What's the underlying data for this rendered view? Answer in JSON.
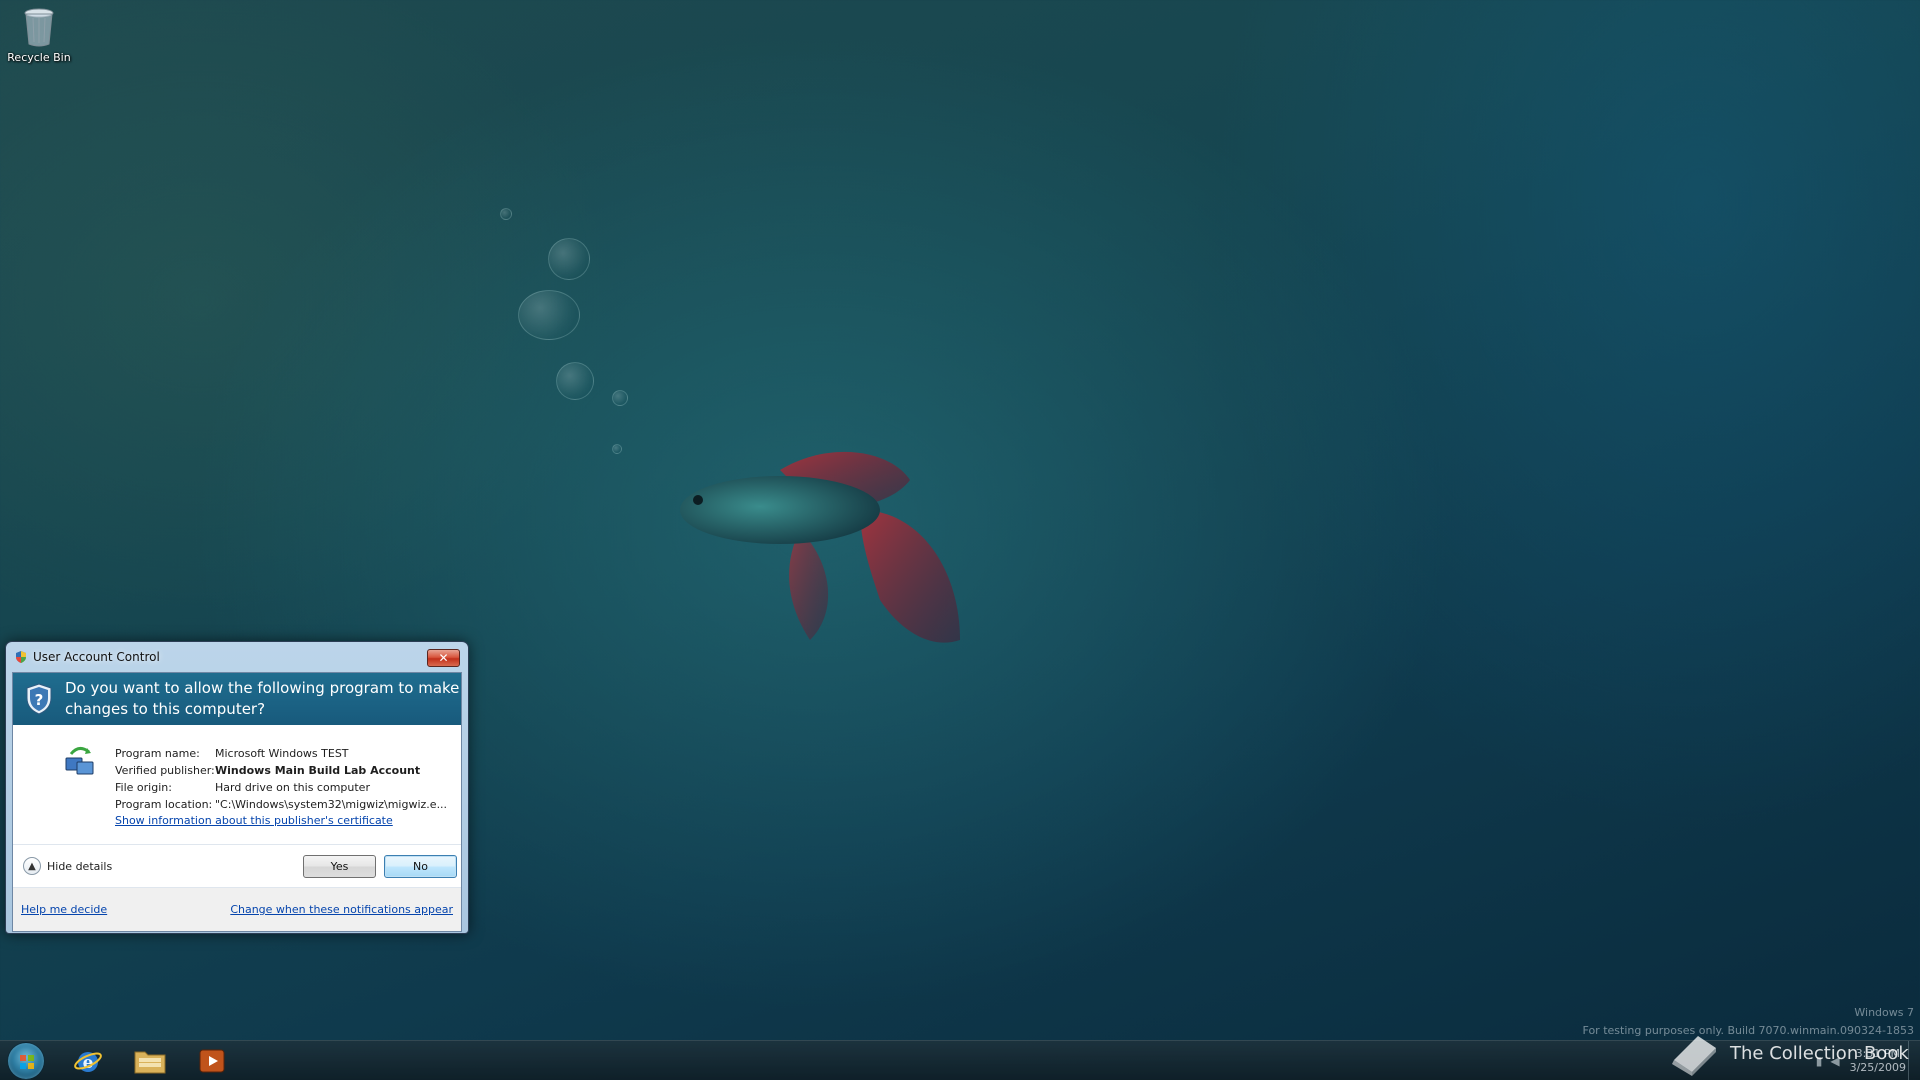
{
  "desktop": {
    "icons": [
      {
        "label": "Recycle Bin",
        "icon": "recycle-bin-icon"
      }
    ]
  },
  "uac": {
    "title": "User Account Control",
    "close_label": "✕",
    "question": "Do you want to allow the following program to make changes to this computer?",
    "details": [
      {
        "key": "Program name:",
        "value": "Microsoft Windows TEST",
        "bold": false
      },
      {
        "key": "Verified publisher:",
        "value": "Windows Main Build Lab Account",
        "bold": true
      },
      {
        "key": "File origin:",
        "value": "Hard drive on this computer",
        "bold": false
      },
      {
        "key": "Program location:",
        "value": "\"C:\\Windows\\system32\\migwiz\\migwiz.e...",
        "bold": false
      }
    ],
    "certificate_link": "Show information about this publisher's certificate",
    "toggle_details": "Hide details",
    "yes_label": "Yes",
    "no_label": "No",
    "help_link": "Help me decide",
    "change_link": "Change when these notifications appear"
  },
  "watermark": {
    "line1": "Windows 7",
    "line2": "For testing purposes only. Build 7070.winmain.090324-1853"
  },
  "taskbar": {
    "pinned": [
      {
        "name": "internet-explorer",
        "icon": "internet-explorer-icon"
      },
      {
        "name": "windows-explorer",
        "icon": "folder-icon"
      },
      {
        "name": "media-player",
        "icon": "media-player-icon"
      }
    ],
    "clock_time": "3:31 PM",
    "clock_date": "3/25/2009"
  },
  "brand": {
    "text": "The Collection Book"
  }
}
